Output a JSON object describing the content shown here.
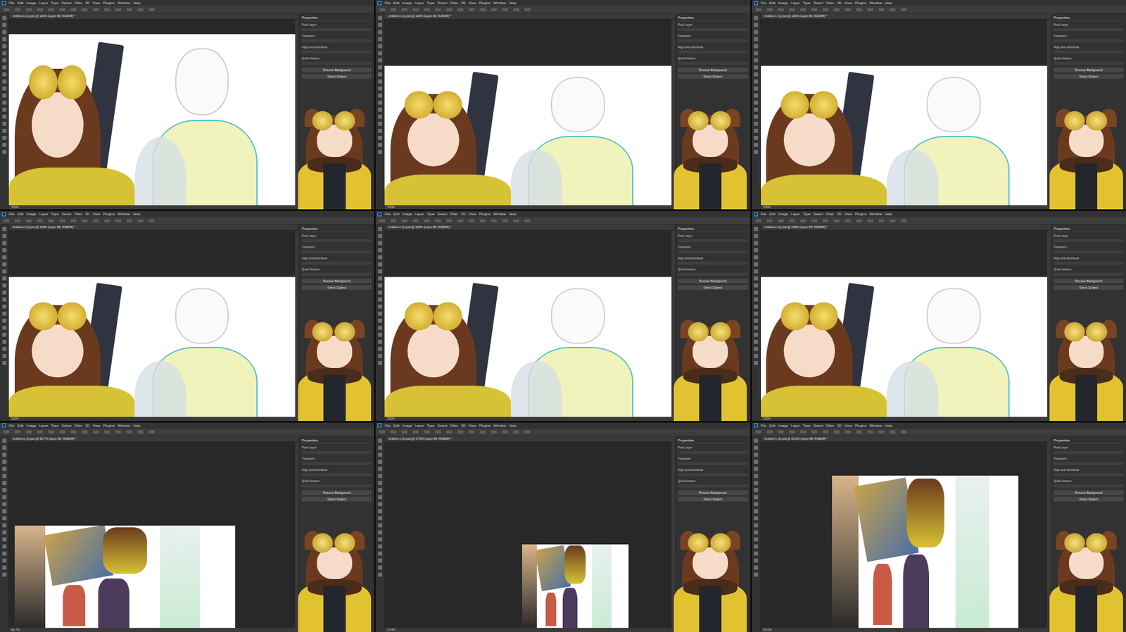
{
  "app": {
    "menu": [
      "File",
      "Edit",
      "Image",
      "Layer",
      "Type",
      "Select",
      "Filter",
      "3D",
      "View",
      "Plugins",
      "Window",
      "Help"
    ],
    "panel": {
      "title": "Properties",
      "sections": [
        "Pixel Layer",
        "Transform",
        "Align and Distribute",
        "Quick Actions"
      ],
      "buttons": [
        "Remove Background",
        "Select Subject"
      ]
    }
  },
  "frames": [
    {
      "tab": "Untitled-1 (1).psd @ 100% (Layer 88, RGB/8#) *",
      "zoom": "100%",
      "view": "a"
    },
    {
      "tab": "Untitled-1 (1).psd @ 100% (Layer 88, RGB/8#) *",
      "zoom": "100%",
      "view": "b"
    },
    {
      "tab": "Untitled-1 (1).psd @ 100% (Layer 88, RGB/8#) *",
      "zoom": "100%",
      "view": "b"
    },
    {
      "tab": "Untitled-1 (1).psd @ 100% (Layer 88, RGB/8#) *",
      "zoom": "100%",
      "view": "b"
    },
    {
      "tab": "Untitled-1 (1).psd @ 100% (Layer 88, RGB/8#) *",
      "zoom": "100%",
      "view": "b"
    },
    {
      "tab": "Untitled-1 (1).psd @ 100% (Layer 88, RGB/8#) *",
      "zoom": "100%",
      "view": "b"
    },
    {
      "tab": "Untitled-1 (1).psd @ 66.7% (Layer 88, RGB/8#) *",
      "zoom": "66.7%",
      "view": "c"
    },
    {
      "tab": "Untitled-1 (1).psd @ 17.8% (Layer 88, RGB/8#) *",
      "zoom": "17.8%",
      "view": "d"
    },
    {
      "tab": "Untitled-1 (1).psd @ 25.1% (Layer 88, RGB/8#) *",
      "zoom": "25.1%",
      "view": "e"
    }
  ]
}
